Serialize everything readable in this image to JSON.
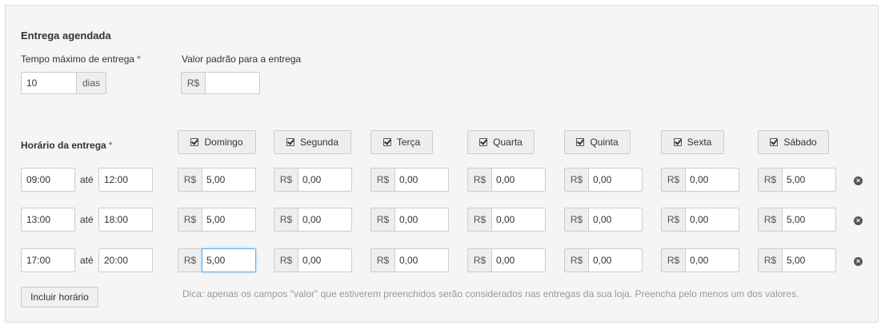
{
  "section_title": "Entrega agendada",
  "max_time": {
    "label": "Tempo máximo de entrega",
    "required_mark": "*",
    "value": "10",
    "unit": "dias"
  },
  "default_value": {
    "label": "Valor padrão para a entrega",
    "currency": "R$",
    "value": ""
  },
  "schedule": {
    "label": "Horário da entrega",
    "required_mark": "*",
    "between_word": "até",
    "currency": "R$",
    "days": [
      "Domingo",
      "Segunda",
      "Terça",
      "Quarta",
      "Quinta",
      "Sexta",
      "Sábado"
    ],
    "rows": [
      {
        "start": "09:00",
        "end": "12:00",
        "prices": [
          "5,00",
          "0,00",
          "0,00",
          "0,00",
          "0,00",
          "0,00",
          "5,00"
        ]
      },
      {
        "start": "13:00",
        "end": "18:00",
        "prices": [
          "5,00",
          "0,00",
          "0,00",
          "0,00",
          "0,00",
          "0,00",
          "5,00"
        ]
      },
      {
        "start": "17:00",
        "end": "20:00",
        "prices": [
          "5,00",
          "0,00",
          "0,00",
          "0,00",
          "0,00",
          "0,00",
          "5,00"
        ]
      }
    ],
    "focused_field": {
      "row": 2,
      "day": 0
    }
  },
  "add_button_label": "Incluir horário",
  "tip": "Dica: apenas os campos \"valor\" que estiverem preenchidos serão considerados nas entregas da sua loja. Preencha pelo menos um dos valores.",
  "icons": {
    "checkbox": "checkbox-checked-icon",
    "remove": "remove-circle-icon"
  }
}
